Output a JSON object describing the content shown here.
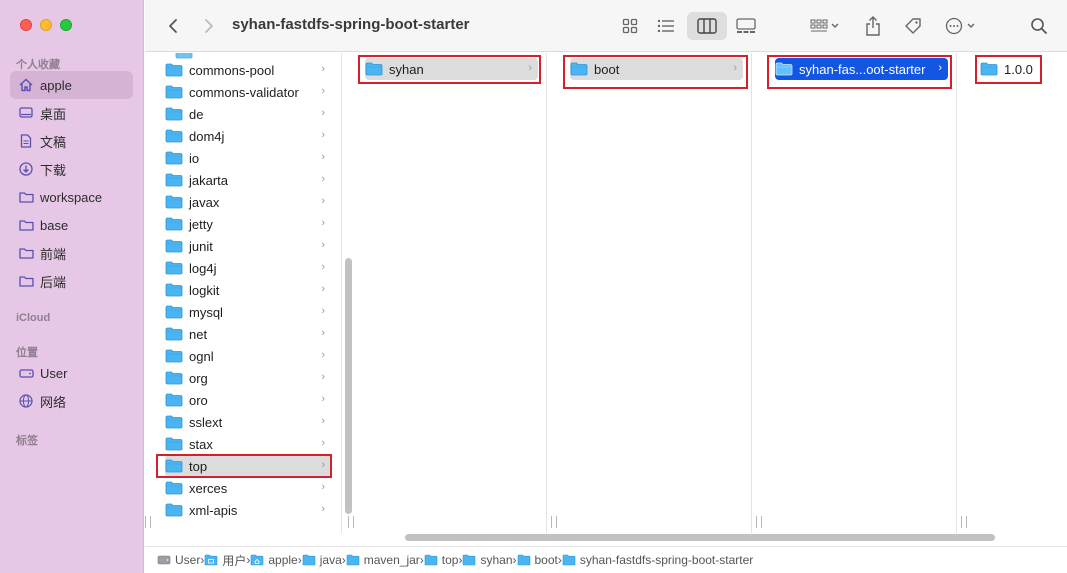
{
  "window": {
    "title": "syhan-fastdfs-spring-boot-starter"
  },
  "sidebar": {
    "favorites_label": "个人收藏",
    "favorites": [
      {
        "label": "apple",
        "icon": "house-icon",
        "active": true
      },
      {
        "label": "桌面",
        "icon": "desktop-icon"
      },
      {
        "label": "文稿",
        "icon": "document-icon"
      },
      {
        "label": "下载",
        "icon": "download-icon"
      },
      {
        "label": "workspace",
        "icon": "folder-icon"
      },
      {
        "label": "base",
        "icon": "folder-icon"
      },
      {
        "label": "前端",
        "icon": "folder-icon"
      },
      {
        "label": "后端",
        "icon": "folder-icon"
      }
    ],
    "icloud_label": "iCloud",
    "locations_label": "位置",
    "locations": [
      {
        "label": "User",
        "icon": "disk-icon"
      },
      {
        "label": "网络",
        "icon": "globe-icon"
      }
    ],
    "tags_label": "标签"
  },
  "toolbar": {
    "view_modes": [
      "icon-view",
      "list-view",
      "column-view",
      "gallery-view"
    ],
    "active_view": "column-view"
  },
  "columns": [
    {
      "items": [
        "commons-pool",
        "commons-validator",
        "de",
        "dom4j",
        "io",
        "jakarta",
        "javax",
        "jetty",
        "junit",
        "log4j",
        "logkit",
        "mysql",
        "net",
        "ognl",
        "org",
        "oro",
        "sslext",
        "stax",
        "top",
        "xerces",
        "xml-apis"
      ],
      "selected": "top"
    },
    {
      "items": [
        "syhan"
      ],
      "selected": "syhan"
    },
    {
      "items": [
        "boot"
      ],
      "selected": "boot"
    },
    {
      "items": [
        "syhan-fas...oot-starter"
      ],
      "selected": "syhan-fas...oot-starter"
    },
    {
      "items": [
        "1.0.0"
      ],
      "selected": ""
    }
  ],
  "pathbar": [
    "User",
    "用户",
    "apple",
    "java",
    "maven_jar",
    "top",
    "syhan",
    "boot",
    "syhan-fastdfs-spring-boot-starter"
  ],
  "colors": {
    "accent": "#1256e3",
    "highlight_box": "#d3202a",
    "sidebar_bg": "#e6c8e6",
    "folder": "#4bb5f2"
  }
}
